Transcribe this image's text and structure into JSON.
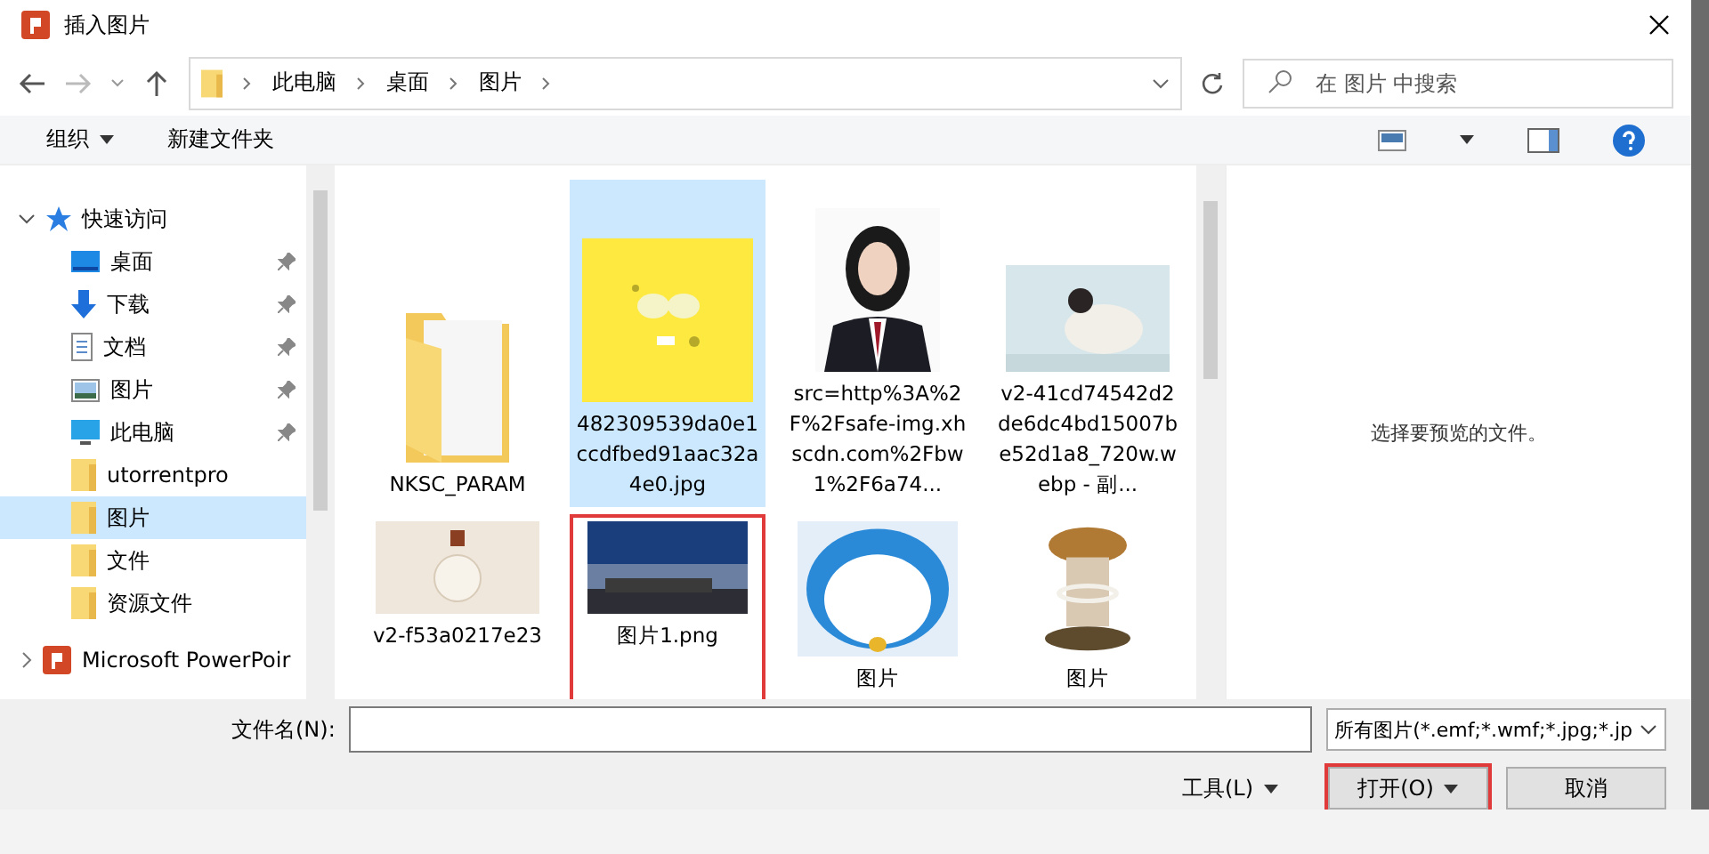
{
  "window": {
    "title": "插入图片"
  },
  "breadcrumb": [
    "此电脑",
    "桌面",
    "图片"
  ],
  "search": {
    "placeholder": "在 图片 中搜索"
  },
  "toolbar": {
    "organize": "组织",
    "new_folder": "新建文件夹"
  },
  "sidebar": {
    "root": {
      "label": "快速访问",
      "expanded": true
    },
    "items": [
      {
        "label": "桌面",
        "kind": "desktop",
        "pinned": true,
        "selected": false
      },
      {
        "label": "下载",
        "kind": "download",
        "pinned": true,
        "selected": false
      },
      {
        "label": "文档",
        "kind": "document",
        "pinned": true,
        "selected": false
      },
      {
        "label": "图片",
        "kind": "pictures",
        "pinned": true,
        "selected": false
      },
      {
        "label": "此电脑",
        "kind": "computer",
        "pinned": true,
        "selected": false
      },
      {
        "label": "utorrentpro",
        "kind": "folder",
        "pinned": false,
        "selected": false
      },
      {
        "label": "图片",
        "kind": "folder",
        "pinned": false,
        "selected": true
      },
      {
        "label": "文件",
        "kind": "folder",
        "pinned": false,
        "selected": false
      },
      {
        "label": "资源文件",
        "kind": "folder",
        "pinned": false,
        "selected": false
      }
    ],
    "footer": {
      "label": "Microsoft PowerPoir",
      "expanded": false
    }
  },
  "files": [
    {
      "name": "NKSC_PARAM",
      "kind": "folder",
      "selected": false,
      "highlighted": false
    },
    {
      "name": "482309539da0e1ccdfbed91aac32a4e0.jpg",
      "kind": "picture",
      "selected": true,
      "highlighted": false
    },
    {
      "name": "src=http%3A%2F%2Fsafe-img.xhscdn.com%2Fbw1%2F6a74...",
      "kind": "picture",
      "selected": false,
      "highlighted": false
    },
    {
      "name": "v2-41cd74542d2de6dc4bd15007be52d1a8_720w.webp - 副...",
      "kind": "picture",
      "selected": false,
      "highlighted": false
    },
    {
      "name": "v2-f53a0217e23",
      "kind": "picture",
      "selected": false,
      "highlighted": false
    },
    {
      "name": "图片1.png",
      "kind": "picture",
      "selected": false,
      "highlighted": true
    },
    {
      "name": "图片",
      "kind": "picture",
      "selected": false,
      "highlighted": false
    },
    {
      "name": "图片",
      "kind": "picture",
      "selected": false,
      "highlighted": false
    }
  ],
  "preview": {
    "message": "选择要预览的文件。"
  },
  "filename": {
    "label": "文件名(N):"
  },
  "filter": {
    "value": "所有图片(*.emf;*.wmf;*.jpg;*.jp"
  },
  "buttons": [
    {
      "label": "工具(L)",
      "kind": "menu",
      "highlighted": false
    },
    {
      "label": "打开(O)",
      "kind": "split",
      "highlighted": true
    },
    {
      "label": "取消",
      "kind": "plain",
      "highlighted": false
    }
  ]
}
